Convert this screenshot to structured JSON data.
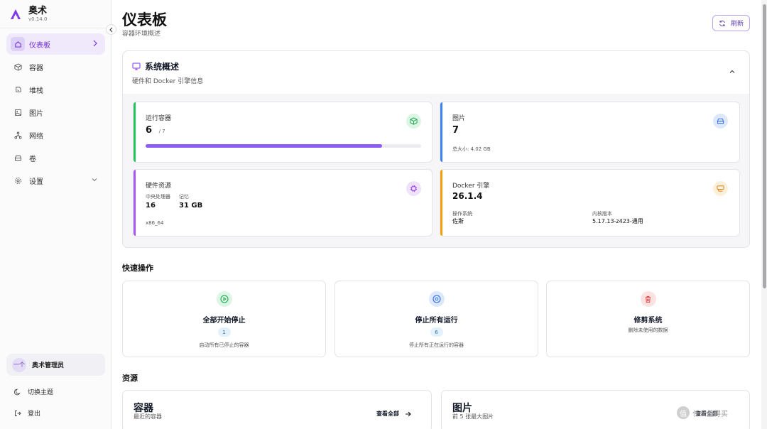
{
  "app": {
    "name": "奥术",
    "version": "v0.14.0"
  },
  "sidebar": {
    "items": [
      {
        "label": "仪表板",
        "icon": "home-icon",
        "active": true
      },
      {
        "label": "容器",
        "icon": "cube-icon"
      },
      {
        "label": "堆栈",
        "icon": "layers-icon"
      },
      {
        "label": "图片",
        "icon": "image-icon"
      },
      {
        "label": "网络",
        "icon": "network-icon"
      },
      {
        "label": "卷",
        "icon": "drive-icon"
      },
      {
        "label": "设置",
        "icon": "gear-icon"
      }
    ],
    "user": {
      "avatar_text": "一个",
      "name": "奥术管理员"
    },
    "toggle_theme": "切换主题",
    "logout": "登出"
  },
  "header": {
    "title": "仪表板",
    "subtitle": "容器环境概述",
    "refresh_label": "刷新"
  },
  "overview": {
    "title": "系统概述",
    "subtitle": "硬件和 Docker 引擎信息",
    "running": {
      "label": "运行容器",
      "value": "6",
      "total": "/ 7",
      "progress": 0.857
    },
    "images": {
      "label": "图片",
      "value": "7",
      "size": "总大小: 4.02 GB"
    },
    "hardware": {
      "label": "硬件资源",
      "cpu_label": "中央处理器",
      "cpu_value": "16",
      "mem_label": "记忆",
      "mem_value": "31 GB",
      "arch": "x86_64"
    },
    "docker": {
      "label": "Docker 引擎",
      "version": "26.1.4",
      "os_label": "操作系统",
      "os_value": "佐斯",
      "kernel_label": "内核版本",
      "kernel_value": "5.17.13-z423-通用"
    }
  },
  "quick": {
    "title": "快速操作",
    "actions": [
      {
        "name": "全部开始停止",
        "count": "1",
        "desc": "启动所有已停止的容器"
      },
      {
        "name": "停止所有运行",
        "count": "6",
        "desc": "停止所有正在运行的容器"
      },
      {
        "name": "修剪系统",
        "desc": "删除未使用的数据"
      }
    ]
  },
  "resources": {
    "title": "资源",
    "containers": {
      "title": "容器",
      "subtitle": "最近的容器",
      "action": "查看全部"
    },
    "images": {
      "title": "图片",
      "subtitle": "前 5 张最大图片",
      "action": "查看全部"
    }
  },
  "colors": {
    "accent": "#7c3aed",
    "green": "#22c55e",
    "blue": "#3b82f6",
    "orange": "#f59e0b",
    "purple": "#a855f7",
    "red": "#ef4444"
  },
  "watermark": "什么值得买"
}
